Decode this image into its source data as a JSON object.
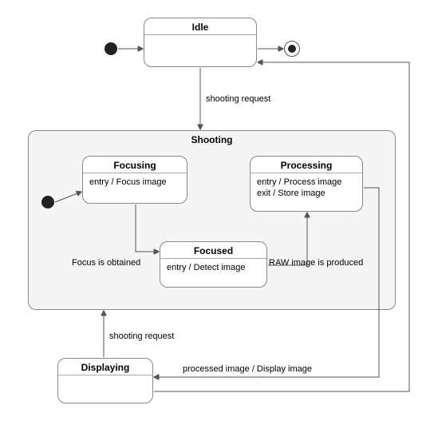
{
  "chart_data": {
    "type": "uml_state_machine",
    "states": [
      {
        "id": "idle",
        "name": "Idle",
        "kind": "simple"
      },
      {
        "id": "shooting",
        "name": "Shooting",
        "kind": "composite",
        "substates": [
          {
            "id": "focusing",
            "name": "Focusing",
            "entry": "Focus image"
          },
          {
            "id": "focused",
            "name": "Focused",
            "entry": "Detect image"
          },
          {
            "id": "processing",
            "name": "Processing",
            "entry": "Process image",
            "exit": "Store image"
          }
        ]
      },
      {
        "id": "displaying",
        "name": "Displaying",
        "kind": "simple"
      }
    ],
    "transitions": [
      {
        "from": "initial_top",
        "to": "idle"
      },
      {
        "from": "idle",
        "to": "final_top"
      },
      {
        "from": "idle",
        "to": "shooting",
        "trigger": "shooting request"
      },
      {
        "from": "initial_shooting",
        "to": "focusing"
      },
      {
        "from": "focusing",
        "to": "focused",
        "guard": "Focus is obtained"
      },
      {
        "from": "focused",
        "to": "processing",
        "guard": "RAW image is produced"
      },
      {
        "from": "processing",
        "to": "displaying",
        "trigger": "processed image",
        "effect": "Display image"
      },
      {
        "from": "displaying",
        "to": "shooting",
        "trigger": "shooting request"
      },
      {
        "from": "displaying",
        "to": "idle"
      }
    ]
  },
  "idle": {
    "title": "Idle"
  },
  "shooting": {
    "title": "Shooting"
  },
  "focusing": {
    "title": "Focusing",
    "body": "entry / Focus image"
  },
  "focused": {
    "title": "Focused",
    "body": "entry / Detect image"
  },
  "processing": {
    "title": "Processing",
    "body1": "entry / Process image",
    "body2": "exit / Store image"
  },
  "displaying": {
    "title": "Displaying"
  },
  "labels": {
    "idle_to_shooting": "shooting request",
    "focus_obtained": "Focus is obtained",
    "raw_produced": "RAW image is produced",
    "proc_to_disp": "processed image / Display image",
    "disp_to_shoot": "shooting request"
  }
}
